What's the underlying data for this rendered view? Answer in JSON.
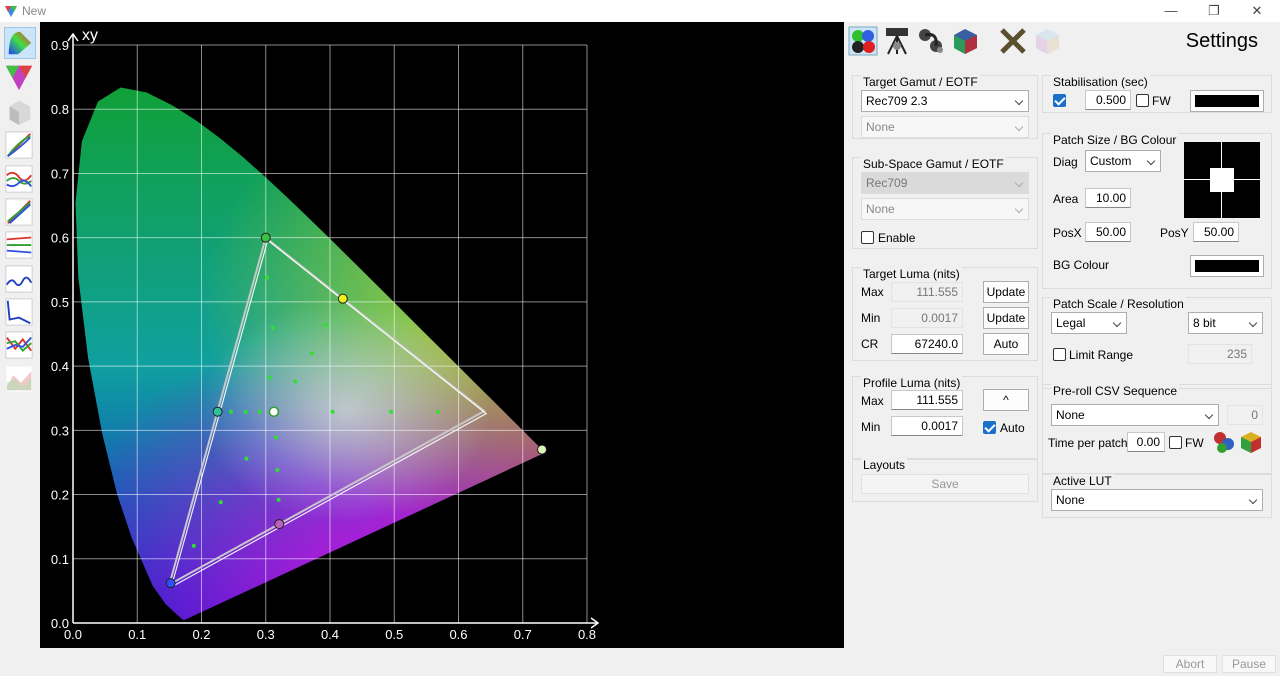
{
  "window": {
    "title": "New",
    "minimize": "—",
    "maximize": "❐",
    "close": "✕"
  },
  "toolbar_left": [
    "color-wheel",
    "gamut-triangle",
    "cube",
    "rgb-curve",
    "rgb-balance",
    "gamma-curve",
    "rgb-levels",
    "luminance-curve",
    "delta-e-graph",
    "rgb-deviation",
    "saturation-graph"
  ],
  "settings_title": "Settings",
  "target_gamut": {
    "title": "Target Gamut / EOTF",
    "gamut": "Rec709 2.3",
    "eotf": "None"
  },
  "subspace": {
    "title": "Sub-Space  Gamut / EOTF",
    "gamut": "Rec709",
    "eotf": "None",
    "enable_label": "Enable"
  },
  "target_luma": {
    "title": "Target Luma (nits)",
    "max_label": "Max",
    "max": "111.555",
    "update1": "Update",
    "min_label": "Min",
    "min": "0.0017",
    "update2": "Update",
    "cr_label": "CR",
    "cr": "67240.0",
    "auto": "Auto"
  },
  "profile_luma": {
    "title": "Profile Luma (nits)",
    "max_label": "Max",
    "max": "111.555",
    "up": "^",
    "min_label": "Min",
    "min": "0.0017",
    "auto_label": "Auto"
  },
  "layouts": {
    "title": "Layouts",
    "save": "Save"
  },
  "stabilisation": {
    "title": "Stabilisation (sec)",
    "value": "0.500",
    "fw_label": "FW"
  },
  "patch_size": {
    "title": "Patch Size / BG Colour",
    "diag_label": "Diag",
    "diag_value": "Custom",
    "area_label": "Area",
    "area": "10.00",
    "posx_label": "PosX",
    "posx": "50.00",
    "posy_label": "PosY",
    "posy": "50.00",
    "bg_label": "BG Colour"
  },
  "patch_scale": {
    "title": "Patch Scale / Resolution",
    "scale": "Legal",
    "bits": "8 bit",
    "limit_label": "Limit Range",
    "limit_value": "235"
  },
  "preroll": {
    "title": "Pre-roll CSV Sequence",
    "value": "None",
    "count": "0",
    "time_label": "Time per patch",
    "time": "0.00",
    "fw_label": "FW"
  },
  "active_lut": {
    "title": "Active LUT",
    "value": "None"
  },
  "status": {
    "abort": "Abort",
    "pause": "Pause"
  },
  "chart_data": {
    "type": "scatter",
    "title": "xy",
    "xlim": [
      0,
      0.8
    ],
    "ylim": [
      0,
      0.9
    ],
    "x_ticks": [
      "0.0",
      "0.1",
      "0.2",
      "0.3",
      "0.4",
      "0.5",
      "0.6",
      "0.7",
      "0.8"
    ],
    "y_ticks": [
      "0.0",
      "0.1",
      "0.2",
      "0.3",
      "0.4",
      "0.5",
      "0.6",
      "0.7",
      "0.8",
      "0.9"
    ],
    "grid": true,
    "target_triangle": [
      [
        0.64,
        0.33
      ],
      [
        0.3,
        0.6
      ],
      [
        0.15,
        0.06
      ]
    ],
    "measured_triangle": [
      [
        0.64,
        0.33
      ],
      [
        0.3,
        0.6
      ],
      [
        0.15,
        0.06
      ]
    ],
    "primaries": [
      {
        "x": 0.73,
        "y": 0.27,
        "color": "#d9f5b8"
      },
      {
        "x": 0.3,
        "y": 0.6,
        "color": "#38c040"
      },
      {
        "x": 0.152,
        "y": 0.062,
        "color": "#3050ff"
      }
    ],
    "secondaries": [
      {
        "x": 0.42,
        "y": 0.505,
        "color": "#f0f020"
      },
      {
        "x": 0.225,
        "y": 0.329,
        "color": "#30c0a0"
      },
      {
        "x": 0.321,
        "y": 0.154,
        "color": "#c060c0"
      }
    ],
    "white_point": {
      "x": 0.3127,
      "y": 0.329,
      "color": "#ffffff"
    },
    "sat_points": [
      [
        0.2458,
        0.329
      ],
      [
        0.2688,
        0.329
      ],
      [
        0.2904,
        0.329
      ],
      [
        0.404,
        0.329
      ],
      [
        0.495,
        0.329
      ],
      [
        0.568,
        0.329
      ],
      [
        0.306,
        0.382
      ],
      [
        0.311,
        0.46
      ],
      [
        0.302,
        0.538
      ],
      [
        0.346,
        0.376
      ],
      [
        0.372,
        0.42
      ],
      [
        0.393,
        0.464
      ],
      [
        0.27,
        0.256
      ],
      [
        0.23,
        0.188
      ],
      [
        0.188,
        0.12
      ],
      [
        0.316,
        0.289
      ],
      [
        0.318,
        0.238
      ],
      [
        0.32,
        0.192
      ]
    ]
  }
}
